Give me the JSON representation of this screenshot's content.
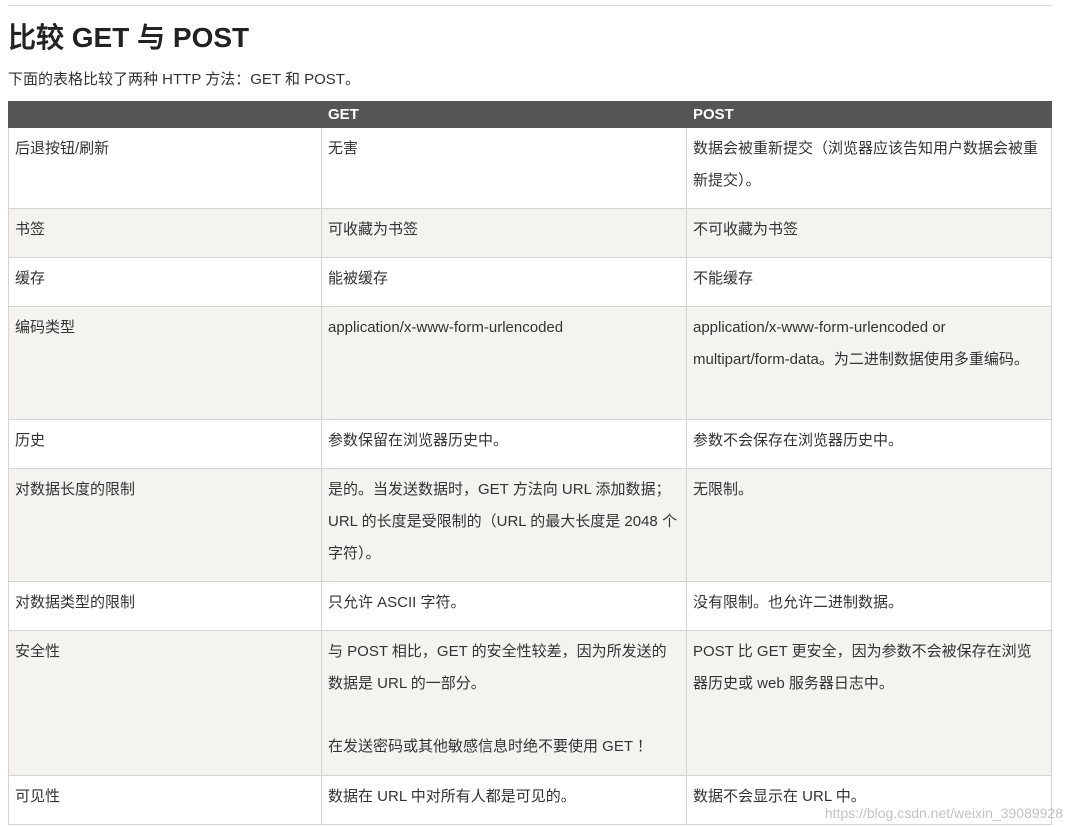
{
  "title": "比较 GET 与 POST",
  "intro": "下面的表格比较了两种 HTTP 方法：GET 和 POST。",
  "table": {
    "headers": [
      "",
      "GET",
      "POST"
    ],
    "rows": [
      {
        "label": "后退按钮/刷新",
        "get": "无害",
        "post": "数据会被重新提交（浏览器应该告知用户数据会被重新提交）。"
      },
      {
        "label": "书签",
        "get": "可收藏为书签",
        "post": "不可收藏为书签"
      },
      {
        "label": "缓存",
        "get": "能被缓存",
        "post": "不能缓存"
      },
      {
        "label": "编码类型",
        "get": "application/x-www-form-urlencoded",
        "post": "application/x-www-form-urlencoded or multipart/form-data。为二进制数据使用多重编码。"
      },
      {
        "label": "历史",
        "get": "参数保留在浏览器历史中。",
        "post": "参数不会保存在浏览器历史中。"
      },
      {
        "label": "对数据长度的限制",
        "get": "是的。当发送数据时，GET 方法向 URL 添加数据；URL 的长度是受限制的（URL 的最大长度是 2048 个字符）。",
        "post": "无限制。"
      },
      {
        "label": "对数据类型的限制",
        "get": "只允许 ASCII 字符。",
        "post": "没有限制。也允许二进制数据。"
      },
      {
        "label": "安全性",
        "get": "与 POST 相比，GET 的安全性较差，因为所发送的数据是 URL 的一部分。",
        "get_note": "在发送密码或其他敏感信息时绝不要使用 GET ！",
        "post": "POST 比 GET 更安全，因为参数不会被保存在浏览器历史或 web 服务器日志中。"
      },
      {
        "label": "可见性",
        "get": "数据在 URL 中对所有人都是可见的。",
        "post": "数据不会显示在 URL 中。"
      }
    ]
  },
  "watermark": "https://blog.csdn.net/weixin_39089928"
}
